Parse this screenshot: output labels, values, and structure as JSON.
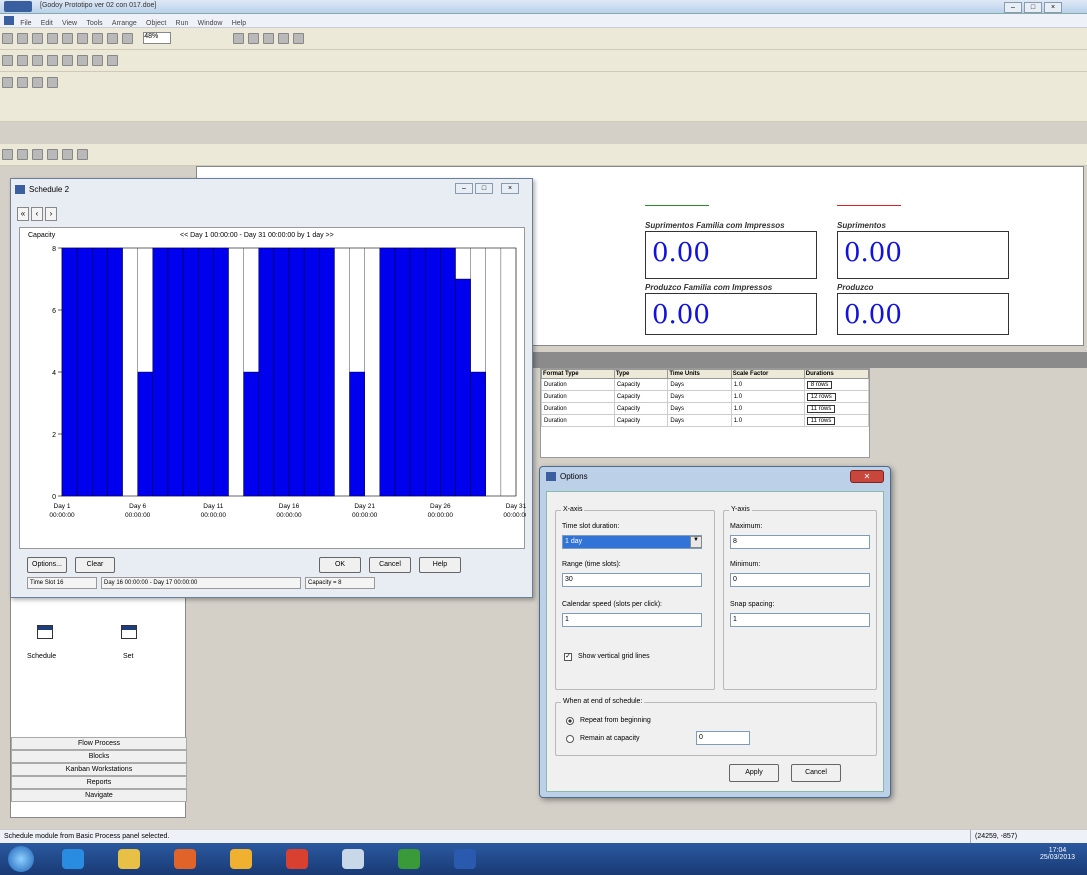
{
  "app": {
    "title": "[Godoy Prototipo ver 02 con 017.doe]",
    "menu": [
      "File",
      "Edit",
      "View",
      "Tools",
      "Arrange",
      "Object",
      "Run",
      "Window",
      "Help"
    ],
    "zoom": "48%"
  },
  "workspace": {
    "labels": [
      "Suprimentos Familia com Impressos",
      "Suprimentos",
      "Produzco Familia com Impressos",
      "Produzco"
    ],
    "values": [
      "0.00",
      "0.00",
      "0.00",
      "0.00"
    ]
  },
  "sheet": {
    "columns": [
      "Format Type",
      "Type",
      "Time Units",
      "Scale Factor",
      "Durations"
    ],
    "rows": [
      {
        "format": "Duration",
        "type": "Capacity",
        "units": "Days",
        "scale": "1.0",
        "dur": "8 rows"
      },
      {
        "format": "Duration",
        "type": "Capacity",
        "units": "Days",
        "scale": "1.0",
        "dur": "12 rows"
      },
      {
        "format": "Duration",
        "type": "Capacity",
        "units": "Days",
        "scale": "1.0",
        "dur": "11 rows"
      },
      {
        "format": "Duration",
        "type": "Capacity",
        "units": "Days",
        "scale": "1.0",
        "dur": "11 rows"
      }
    ]
  },
  "schedule": {
    "title": "Schedule 2",
    "subtitle": "Capacity",
    "range_label": "<< Day 1  00:00:00 - Day 31  00:00:00  by 1 day >>",
    "buttons": {
      "options": "Options...",
      "clear": "Clear",
      "ok": "OK",
      "cancel": "Cancel",
      "help": "Help"
    },
    "status": {
      "slot": "Time Slot 16",
      "interval": "Day 16  00:00:00 - Day 17  00:00:00",
      "capacity": "Capacity = 8"
    }
  },
  "chart_data": {
    "type": "bar",
    "title": "Capacity",
    "ylim": [
      0,
      8
    ],
    "yticks": [
      "8",
      "6",
      "4",
      "2",
      "0"
    ],
    "xtick_labels": [
      "Day 1\n00:00:00",
      "Day 6\n00:00:00",
      "Day 11\n00:00:00",
      "Day 16\n00:00:00",
      "Day 21\n00:00:00",
      "Day 26\n00:00:00",
      "Day 31\n00:00:00"
    ],
    "categories": [
      "1",
      "2",
      "3",
      "4",
      "5",
      "6",
      "7",
      "8",
      "9",
      "10",
      "11",
      "12",
      "13",
      "14",
      "15",
      "16",
      "17",
      "18",
      "19",
      "20",
      "21",
      "22",
      "23",
      "24",
      "25",
      "26",
      "27",
      "28",
      "29",
      "30"
    ],
    "values": [
      8,
      8,
      8,
      8,
      0,
      4,
      8,
      8,
      8,
      8,
      8,
      0,
      4,
      8,
      8,
      8,
      8,
      8,
      0,
      4,
      0,
      8,
      8,
      8,
      8,
      8,
      7,
      4,
      0,
      0
    ],
    "bar_color": "#0000ee",
    "grid": "vertical"
  },
  "options": {
    "title": "Options",
    "xaxis": {
      "label": "X-axis",
      "time_slot_label": "Time slot duration:",
      "time_slot_value": "1 day",
      "range_label": "Range (time slots):",
      "range_value": "30",
      "calendar_label": "Calendar speed (slots per click):",
      "calendar_value": "1",
      "gridlines_label": "Show vertical grid lines"
    },
    "yaxis": {
      "label": "Y-axis",
      "max_label": "Maximum:",
      "max_value": "8",
      "min_label": "Minimum:",
      "min_value": "0",
      "snap_label": "Snap spacing:",
      "snap_value": "1"
    },
    "end": {
      "label": "When at end of schedule:",
      "repeat": "Repeat from beginning",
      "remain": "Remain at capacity",
      "remain_value": "0"
    },
    "apply": "Apply",
    "cancel": "Cancel"
  },
  "panel": {
    "icons": [
      "Schedule",
      "Set"
    ],
    "items": [
      "Flow Process",
      "Blocks",
      "Kanban Workstations",
      "Reports",
      "Navigate"
    ]
  },
  "status": {
    "message": "Schedule module from Basic Process panel selected.",
    "coords": "(24259, -857)"
  },
  "clock": {
    "time": "17:04",
    "date": "25/03/2013"
  }
}
